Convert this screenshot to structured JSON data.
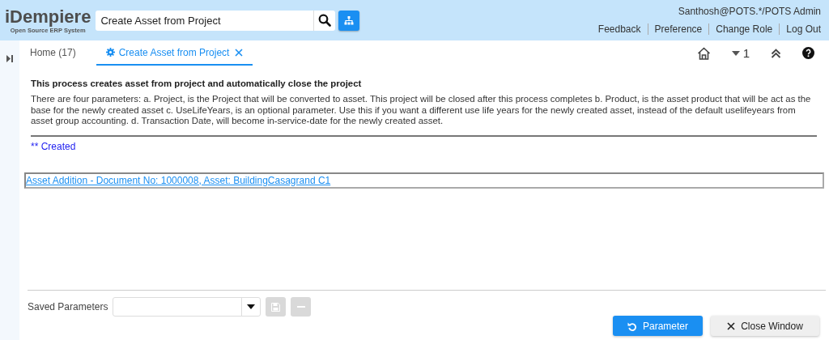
{
  "logo": {
    "title": "iDempiere",
    "subtitle": "Open Source ERP System"
  },
  "search": {
    "value": "Create Asset from Project"
  },
  "user": "Santhosh@POTS.*/POTS Admin",
  "header_links": [
    "Feedback",
    "Preference",
    "Change Role",
    "Log Out"
  ],
  "tabs": [
    {
      "label": "Home (17)",
      "selected": false,
      "closable": false
    },
    {
      "label": "Create Asset from Project",
      "selected": true,
      "closable": true
    }
  ],
  "tab_toolbar": {
    "count": "1"
  },
  "process": {
    "title": "This process creates asset from project and automatically close the project",
    "description": "There are four parameters: a. Project, is the Project that will be converted to asset. This project will be closed after this process completes b. Product, is the asset product that will be act as the base for the newly created asset c. UseLifeYears, is an optional parameter. Use this if you want a different use life years for the newly created asset, instead of the default uselifeyears from asset group accounting. d. Transaction Date, will become in-service-date for the newly created asset.",
    "status": "** Created",
    "result_link": "Asset Addition - Document No: 1000008, Asset: BuildingCasagrand C1"
  },
  "saved_parameters": {
    "label": "Saved Parameters",
    "actions": [
      {
        "kind": "save",
        "disabled": true
      },
      {
        "kind": "delete",
        "disabled": true
      }
    ]
  },
  "buttons": [
    {
      "label": "Parameter",
      "kind": "primary"
    },
    {
      "label": "Close Window",
      "kind": "secondary"
    }
  ]
}
